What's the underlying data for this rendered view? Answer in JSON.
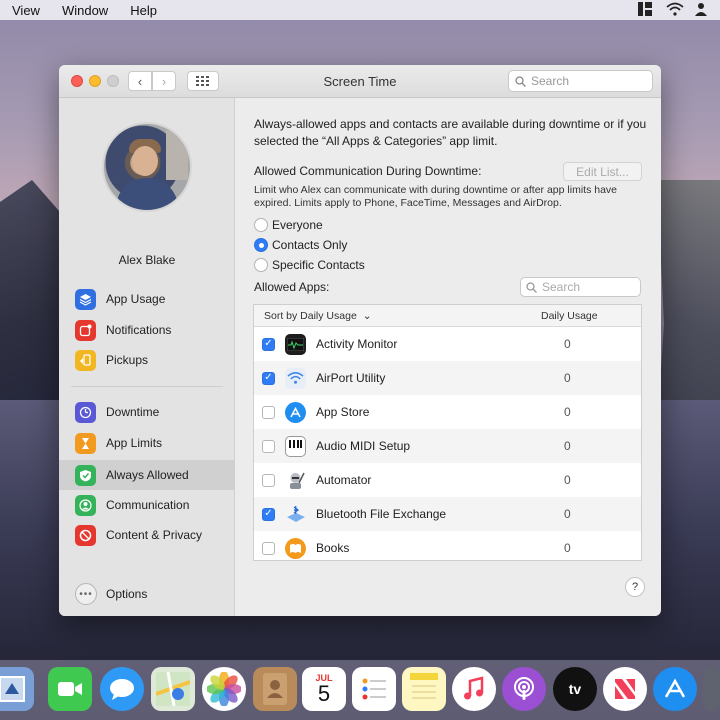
{
  "menubar": {
    "items": [
      "View",
      "Window",
      "Help"
    ]
  },
  "window": {
    "title": "Screen Time",
    "search_placeholder": "Search"
  },
  "user": {
    "name": "Alex Blake"
  },
  "sidebar": {
    "items": [
      {
        "label": "App Usage",
        "icon": "layers-icon",
        "color": "#2f6fe0"
      },
      {
        "label": "Notifications",
        "icon": "notification-icon",
        "color": "#e5372d"
      },
      {
        "label": "Pickups",
        "icon": "pickup-icon",
        "color": "#f2b620"
      },
      {
        "label": "Downtime",
        "icon": "downtime-icon",
        "color": "#5b58d6"
      },
      {
        "label": "App Limits",
        "icon": "hourglass-icon",
        "color": "#f29a1f"
      },
      {
        "label": "Always Allowed",
        "icon": "checkmark-shield-icon",
        "color": "#34b35a"
      },
      {
        "label": "Communication",
        "icon": "person-icon",
        "color": "#34b35a"
      },
      {
        "label": "Content & Privacy",
        "icon": "no-entry-icon",
        "color": "#e5372d"
      }
    ],
    "options_label": "Options"
  },
  "content": {
    "description": "Always-allowed apps and contacts are available during downtime or if you selected the “All Apps & Categories” app limit.",
    "communication_label": "Allowed Communication During Downtime:",
    "edit_list_label": "Edit List...",
    "communication_description": "Limit who Alex can communicate with during downtime or after app limits have expired. Limits apply to Phone, FaceTime, Messages and AirDrop.",
    "radio_options": [
      {
        "label": "Everyone",
        "selected": false
      },
      {
        "label": "Contacts Only",
        "selected": true
      },
      {
        "label": "Specific Contacts",
        "selected": false
      }
    ],
    "apps_label": "Allowed Apps:",
    "apps_search_placeholder": "Search",
    "table": {
      "sort_header": "Sort by Daily Usage",
      "usage_header": "Daily Usage",
      "rows": [
        {
          "name": "Activity Monitor",
          "usage": "0",
          "checked": true
        },
        {
          "name": "AirPort Utility",
          "usage": "0",
          "checked": true
        },
        {
          "name": "App Store",
          "usage": "0",
          "checked": false
        },
        {
          "name": "Audio MIDI Setup",
          "usage": "0",
          "checked": false
        },
        {
          "name": "Automator",
          "usage": "0",
          "checked": false
        },
        {
          "name": "Bluetooth File Exchange",
          "usage": "0",
          "checked": true
        },
        {
          "name": "Books",
          "usage": "0",
          "checked": false
        }
      ]
    },
    "help_label": "?"
  },
  "dock": {
    "calendar_month": "JUL",
    "calendar_day": "5",
    "tv_label": "tv"
  }
}
